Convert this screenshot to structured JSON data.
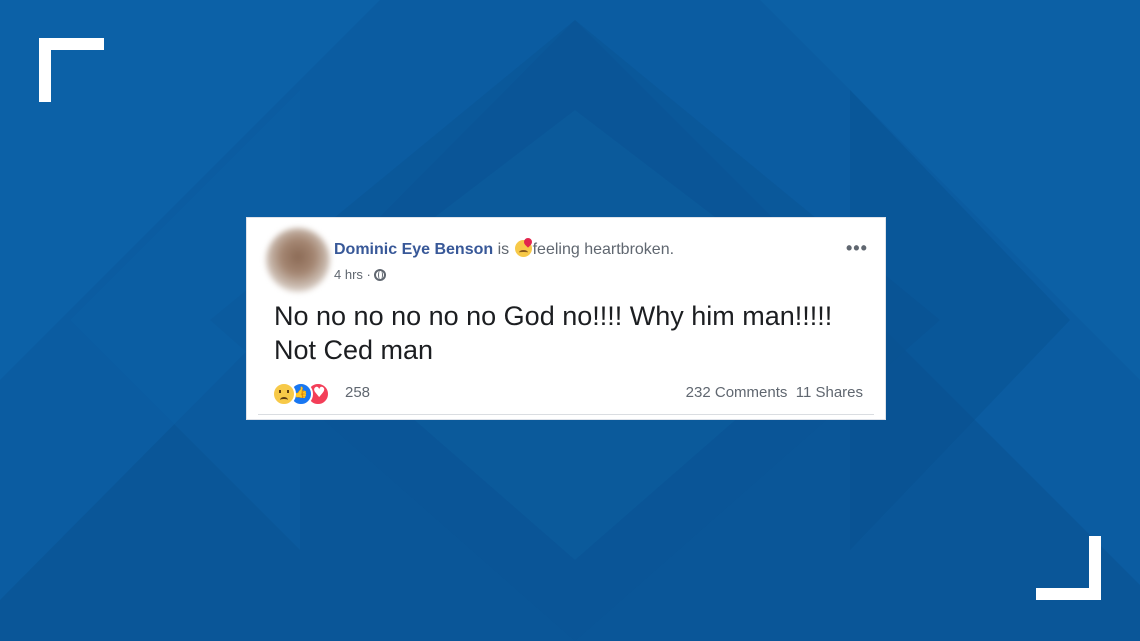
{
  "post": {
    "author": "Dominic Eye Benson",
    "is_text": " is ",
    "feeling": "feeling heartbroken.",
    "time": "4 hrs · ",
    "privacy_icon": "globe-icon",
    "menu_icon": "more-options-icon",
    "menu_label": "•••",
    "text": "No no no no no no God no!!!! Why him man!!!!! Not Ced man",
    "reactions": {
      "icons": [
        "sad-reaction-icon",
        "like-reaction-icon",
        "love-reaction-icon"
      ],
      "count": "258"
    },
    "comments": "232 Comments",
    "shares": "11 Shares"
  },
  "colors": {
    "background": "#0a5a9e",
    "author": "#385898",
    "text": "#1c1e21",
    "secondary": "#606770"
  }
}
